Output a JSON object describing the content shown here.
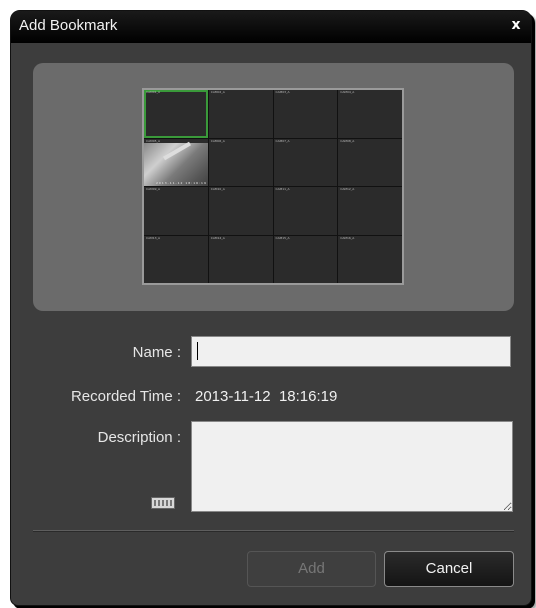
{
  "dialog": {
    "title": "Add Bookmark",
    "close_glyph": "x"
  },
  "preview": {
    "cells": [
      "CAM01_A",
      "CAM02_A",
      "CAM03_A",
      "CAM04_A",
      "CAM05_A",
      "CAM06_A",
      "CAM07_A",
      "CAM08_A",
      "CAM09_A",
      "CAM10_A",
      "CAM11_A",
      "CAM12_A",
      "CAM13_A",
      "CAM14_A",
      "CAM15_A",
      "CAM16_A"
    ],
    "cam_overlay_text": "2013-11-12 18:16:19"
  },
  "form": {
    "name_label": "Name :",
    "name_value": "",
    "recorded_label": "Recorded Time :",
    "recorded_value": "2013-11-12  18:16:19",
    "description_label": "Description :",
    "description_value": ""
  },
  "buttons": {
    "add_label": "Add",
    "cancel_label": "Cancel"
  },
  "icons": {
    "close": "close-icon",
    "keyboard": "keyboard-icon"
  },
  "colors": {
    "dialog_bg": "#3d3d3d",
    "titlebar_bg": "#000000",
    "selected_cell": "#3a9a3a"
  }
}
